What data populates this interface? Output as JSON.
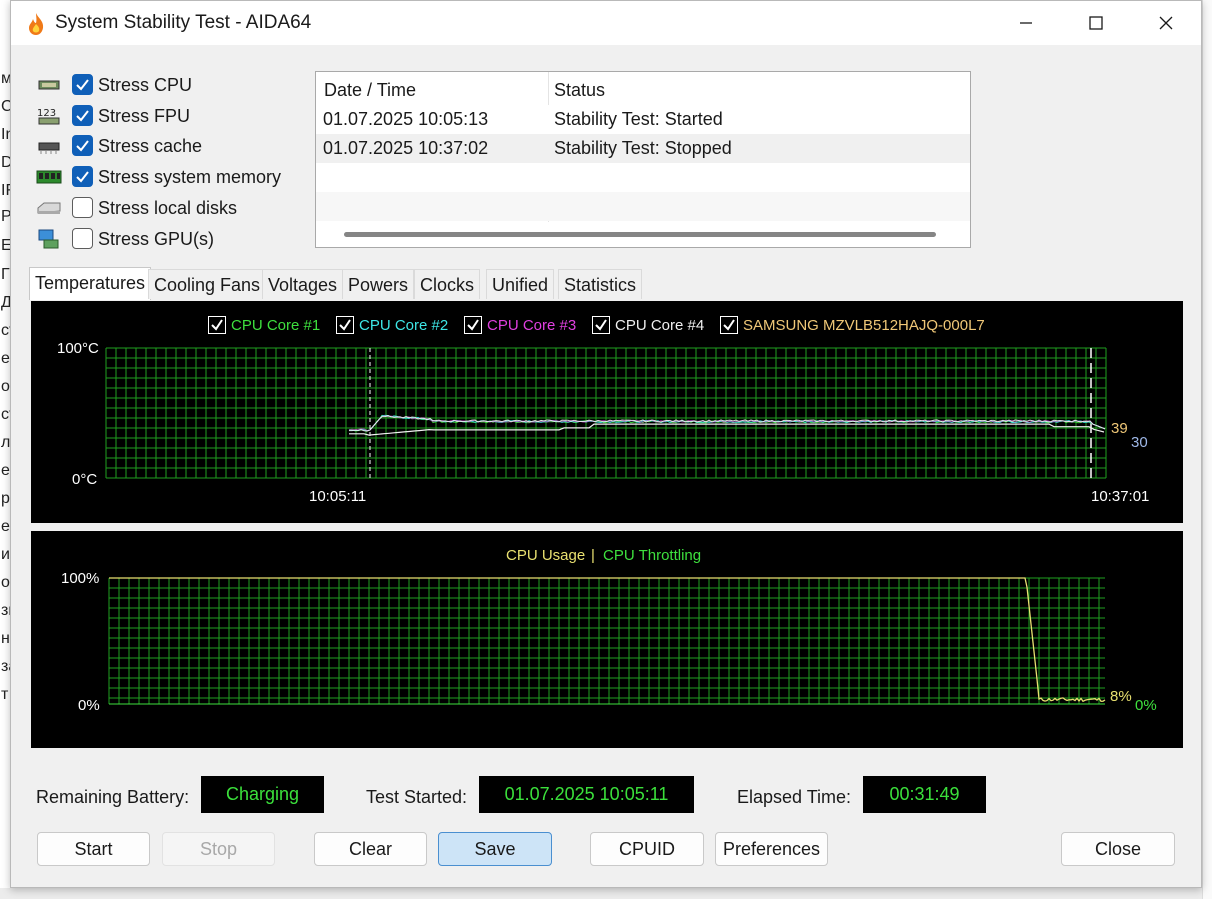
{
  "window": {
    "title": "System Stability Test - AIDA64"
  },
  "background_app": {
    "visible_chars": [
      "м",
      "С",
      "In",
      "D",
      "IF",
      "Р",
      "E",
      "Г",
      "Д",
      "ст",
      "ер",
      "ов",
      "ст",
      "л",
      "ер",
      "р",
      "ес",
      "ис",
      "о",
      "зп",
      "но",
      "за",
      "т"
    ]
  },
  "stress_options": [
    {
      "label": "Stress CPU",
      "checked": true,
      "icon": "cpu-chip-icon"
    },
    {
      "label": "Stress FPU",
      "checked": true,
      "icon": "fpu-123-icon"
    },
    {
      "label": "Stress cache",
      "checked": true,
      "icon": "cache-chip-icon"
    },
    {
      "label": "Stress system memory",
      "checked": true,
      "icon": "memory-module-icon"
    },
    {
      "label": "Stress local disks",
      "checked": false,
      "icon": "disk-drive-icon"
    },
    {
      "label": "Stress GPU(s)",
      "checked": false,
      "icon": "gpu-monitor-icon"
    }
  ],
  "log": {
    "headers": [
      "Date / Time",
      "Status"
    ],
    "rows": [
      {
        "datetime": "01.07.2025 10:05:13",
        "status": "Stability Test: Started"
      },
      {
        "datetime": "01.07.2025 10:37:02",
        "status": "Stability Test: Stopped"
      }
    ]
  },
  "tabs": [
    "Temperatures",
    "Cooling Fans",
    "Voltages",
    "Powers",
    "Clocks",
    "Unified",
    "Statistics"
  ],
  "active_tab": "Temperatures",
  "temperature_graph": {
    "legend": [
      {
        "label": "CPU Core #1",
        "color": "#3ee03e",
        "checked": true
      },
      {
        "label": "CPU Core #2",
        "color": "#3ee6e6",
        "checked": true
      },
      {
        "label": "CPU Core #3",
        "color": "#e040e0",
        "checked": true
      },
      {
        "label": "CPU Core #4",
        "color": "#f0f0f0",
        "checked": true
      },
      {
        "label": "SAMSUNG MZVLB512HAJQ-000L7",
        "color": "#f0c878",
        "checked": true
      }
    ],
    "y_max_label": "100",
    "y_min_label": "0",
    "unit": "°C",
    "x_start_label": "10:05:11",
    "x_end_label": "10:37:01",
    "current_value_label": "39",
    "current_value_label_2": "30",
    "grid_color": "#1fa01f"
  },
  "cpu_graph": {
    "legend_usage": "CPU Usage",
    "legend_separator": "|",
    "legend_throttling": "CPU Throttling",
    "usage_color": "#e8e070",
    "throttling_color": "#3ee03e",
    "y_max_label": "100%",
    "y_min_label": "0%",
    "current_usage_label": "8%",
    "current_throttling_label": "0%"
  },
  "status": {
    "battery_label": "Remaining Battery:",
    "battery_value": "Charging",
    "started_label": "Test Started:",
    "started_value": "01.07.2025 10:05:11",
    "elapsed_label": "Elapsed Time:",
    "elapsed_value": "00:31:49"
  },
  "buttons": {
    "start": "Start",
    "stop": "Stop",
    "clear": "Clear",
    "save": "Save",
    "cpuid": "CPUID",
    "preferences": "Preferences",
    "close": "Close"
  }
}
